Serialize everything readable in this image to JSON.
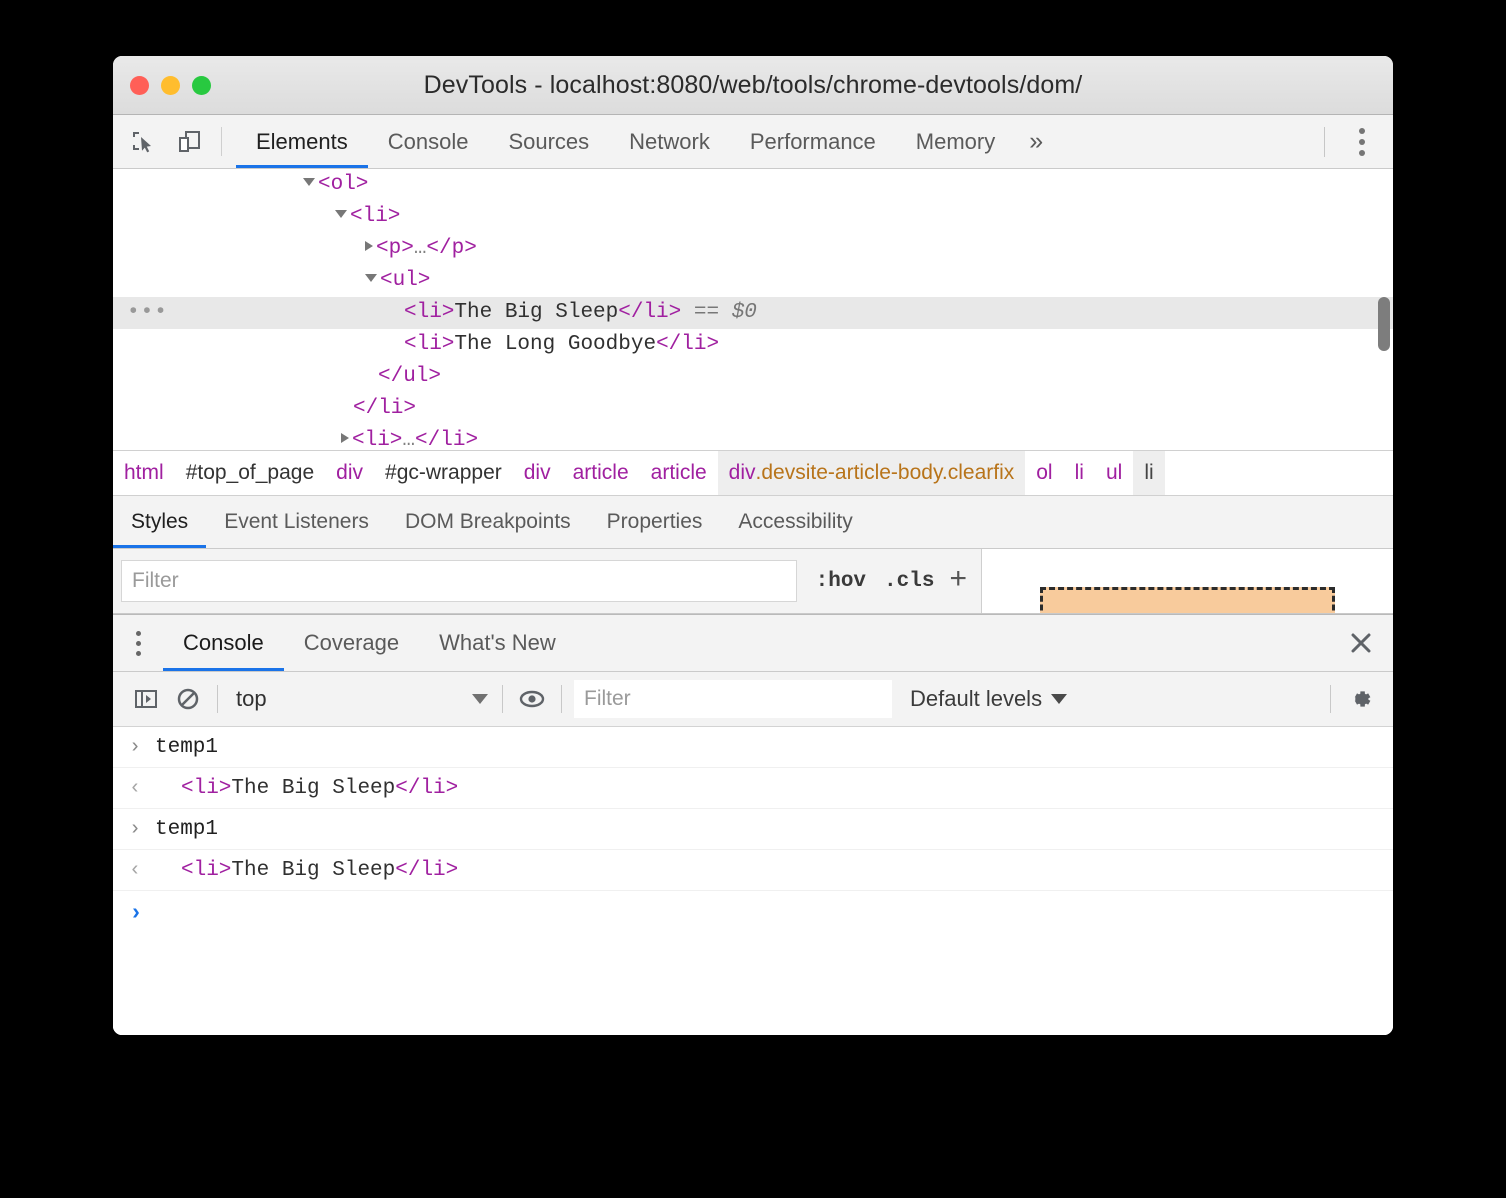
{
  "window": {
    "title": "DevTools - localhost:8080/web/tools/chrome-devtools/dom/",
    "traffic_lights": [
      "close",
      "minimize",
      "zoom"
    ]
  },
  "main_toolbar": {
    "icons": [
      "inspect-element-icon",
      "device-toolbar-icon"
    ],
    "tabs": [
      {
        "label": "Elements",
        "active": true
      },
      {
        "label": "Console",
        "active": false
      },
      {
        "label": "Sources",
        "active": false
      },
      {
        "label": "Network",
        "active": false
      },
      {
        "label": "Performance",
        "active": false
      },
      {
        "label": "Memory",
        "active": false
      }
    ],
    "more_tabs": "»",
    "menu": "more-options-icon"
  },
  "dom_tree": {
    "rows": [
      {
        "indent": 190,
        "twisty": "open",
        "segments": [
          {
            "t": "tag",
            "v": "<ol>"
          }
        ],
        "selected": false
      },
      {
        "indent": 222,
        "twisty": "open",
        "segments": [
          {
            "t": "tag",
            "v": "<li>"
          }
        ],
        "selected": false
      },
      {
        "indent": 252,
        "twisty": "closed",
        "segments": [
          {
            "t": "tag",
            "v": "<p>"
          },
          {
            "t": "dots",
            "v": "…"
          },
          {
            "t": "tag",
            "v": "</p>"
          }
        ],
        "selected": false
      },
      {
        "indent": 252,
        "twisty": "open",
        "segments": [
          {
            "t": "tag",
            "v": "<ul>"
          }
        ],
        "selected": false
      },
      {
        "indent": 291,
        "twisty": "none",
        "segments": [
          {
            "t": "tag",
            "v": "<li>"
          },
          {
            "t": "txt",
            "v": "The Big Sleep"
          },
          {
            "t": "tag",
            "v": "</li>"
          },
          {
            "t": "ref",
            "v": " == "
          },
          {
            "t": "refv",
            "v": "$0"
          }
        ],
        "selected": true,
        "ellipsis": "…"
      },
      {
        "indent": 291,
        "twisty": "none",
        "segments": [
          {
            "t": "tag",
            "v": "<li>"
          },
          {
            "t": "txt",
            "v": "The Long Goodbye"
          },
          {
            "t": "tag",
            "v": "</li>"
          }
        ],
        "selected": false
      },
      {
        "indent": 265,
        "twisty": "none",
        "segments": [
          {
            "t": "tag",
            "v": "</ul>"
          }
        ],
        "selected": false
      },
      {
        "indent": 240,
        "twisty": "none",
        "segments": [
          {
            "t": "tag",
            "v": "</li>"
          }
        ],
        "selected": false
      },
      {
        "indent": 228,
        "twisty": "closed",
        "segments": [
          {
            "t": "tag",
            "v": "<li>"
          },
          {
            "t": "dots",
            "v": "…"
          },
          {
            "t": "tag",
            "v": "</li>"
          }
        ],
        "selected": false
      }
    ]
  },
  "breadcrumb": {
    "items": [
      {
        "label": "html",
        "style": "tag"
      },
      {
        "label": "#top_of_page",
        "style": "id"
      },
      {
        "label": "div",
        "style": "tag"
      },
      {
        "label": "#gc-wrapper",
        "style": "id"
      },
      {
        "label": "div",
        "style": "tag"
      },
      {
        "label": "article",
        "style": "tag"
      },
      {
        "label": "article",
        "style": "tag"
      },
      {
        "label": "div.devsite-article-body.clearfix",
        "style": "highlight",
        "tag": "div",
        "classes": ".devsite-article-body.clearfix"
      },
      {
        "label": "ol",
        "style": "tag"
      },
      {
        "label": "li",
        "style": "tag"
      },
      {
        "label": "ul",
        "style": "tag"
      },
      {
        "label": "li",
        "style": "current"
      }
    ]
  },
  "sidebar_tabs": [
    {
      "label": "Styles",
      "active": true
    },
    {
      "label": "Event Listeners",
      "active": false
    },
    {
      "label": "DOM Breakpoints",
      "active": false
    },
    {
      "label": "Properties",
      "active": false
    },
    {
      "label": "Accessibility",
      "active": false
    }
  ],
  "styles_pane": {
    "filter_placeholder": "Filter",
    "filter_value": "",
    "hov_label": ":hov",
    "cls_label": ".cls",
    "new_rule_label": "+",
    "box_model_color": "#f8cb9c"
  },
  "drawer": {
    "menu": "more-tools-icon",
    "tabs": [
      {
        "label": "Console",
        "active": true
      },
      {
        "label": "Coverage",
        "active": false
      },
      {
        "label": "What's New",
        "active": false
      }
    ],
    "close": "close-icon"
  },
  "console_toolbar": {
    "sidebar_toggle": "console-sidebar-icon",
    "clear": "clear-console-icon",
    "context": "top",
    "eye": "live-expression-icon",
    "filter_placeholder": "Filter",
    "filter_value": "",
    "levels": "Default levels",
    "settings": "settings-gear-icon"
  },
  "console_messages": [
    {
      "kind": "input",
      "gutter": "›",
      "text": "temp1"
    },
    {
      "kind": "output",
      "gutter": "‹",
      "segments": [
        {
          "t": "tag",
          "v": "<li>"
        },
        {
          "t": "txt",
          "v": "The Big Sleep"
        },
        {
          "t": "tag",
          "v": "</li>"
        }
      ]
    },
    {
      "kind": "input",
      "gutter": "›",
      "text": "temp1"
    },
    {
      "kind": "output",
      "gutter": "‹",
      "segments": [
        {
          "t": "tag",
          "v": "<li>"
        },
        {
          "t": "txt",
          "v": "The Big Sleep"
        },
        {
          "t": "tag",
          "v": "</li>"
        }
      ]
    }
  ],
  "console_prompt": {
    "glyph": "›",
    "value": ""
  },
  "colors": {
    "accent_blue": "#1a73e8",
    "tag_purple": "#a020a0",
    "class_orange": "#b8741a",
    "selected_row": "#e8e8e8",
    "chrome_bg": "#f3f3f3"
  }
}
